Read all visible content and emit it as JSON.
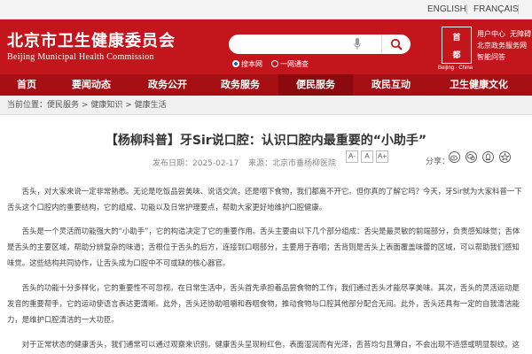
{
  "lang": {
    "english": "ENGLISH",
    "french": "FRANÇAIS"
  },
  "header": {
    "site_name": "北京市卫生健康委员会",
    "site_name_en": "Beijing Municipal Health Commission",
    "search_placeholder": "",
    "radio_site": "搜本网",
    "radio_all": "一网通查",
    "logo_top": "首",
    "logo_bottom": "都",
    "logo_sub": "Beijing · China",
    "quick_links": [
      "用户中心",
      "无障碍",
      "北京政务服务网",
      "智能问答"
    ]
  },
  "nav": {
    "items": [
      "首页",
      "要闻动态",
      "政务公开",
      "政务服务",
      "便民服务",
      "政民互动",
      "卫生健康文化"
    ],
    "active_index": 4
  },
  "breadcrumb": {
    "label": "当前位置：",
    "items": [
      "便民服务",
      "健康知识",
      "健康生活"
    ],
    "separator": ">"
  },
  "article": {
    "title": "【杨柳科普】牙Sir说口腔：认识口腔内最重要的“小助手”",
    "date": "发布日期：2025-02-17",
    "source": "来源：北京市垂杨柳医院",
    "font_sizes": [
      "A-",
      "A",
      "A+"
    ],
    "share_label": "分享：",
    "paragraphs": [
      "舌头，对大家来说一定非常熟悉。无论是吃饭品尝美味、说话交流，还是咽下食物，我们都离不开它。但你真的了解它吗？今天，牙Sir就为大家科普一下舌头这个口腔内的重要结构，它的组成、功能以及日常护理要点，帮助大家更好地维护口腔健康。",
      "舌头是一个灵活而功能强大的“小助手”，它的构造决定了它的重要作用。舌头主要由以下几个部分组成：舌尖是最灵敏的前端部分，负责感知味觉；舌体是舌头的主要区域，帮助分辨复杂的味道；舌根位于舌头的后方，连接到口咽部分，主要用于吞咽；舌背则是舌头上表面覆盖味蕾的区域，可以帮助我们感知味觉。这些结构共同协作，让舌头成为口腔中不可或缺的核心器官。",
      "舌头的功能十分多样化，它的重要性不可忽视。在日常生活中，舌头首先承担着品尝食物的工作，我们通过舌头才能尽享美味。其次，舌头的灵活运动是发音的重要帮手，它的运动使语言表达更清晰。此外，舌头还协助咀嚼和吞咽食物，推动食物与口腔其他部分配合无间。此外，舌头还具有一定的自我清洁能力，是维护口腔清洁的一大功臣。",
      "对于正常状态的健康舌头，我们通常可以通过观察来识别。健康舌头呈现粉红色，表面湿润而有光泽，舌苔均匀且薄白，不会出现不适感或明显裂纹。这种状态"
    ]
  },
  "colors": {
    "brand_red": "#c3161c",
    "nav_red": "#a50f14",
    "nav_active": "#8a0a0f"
  }
}
